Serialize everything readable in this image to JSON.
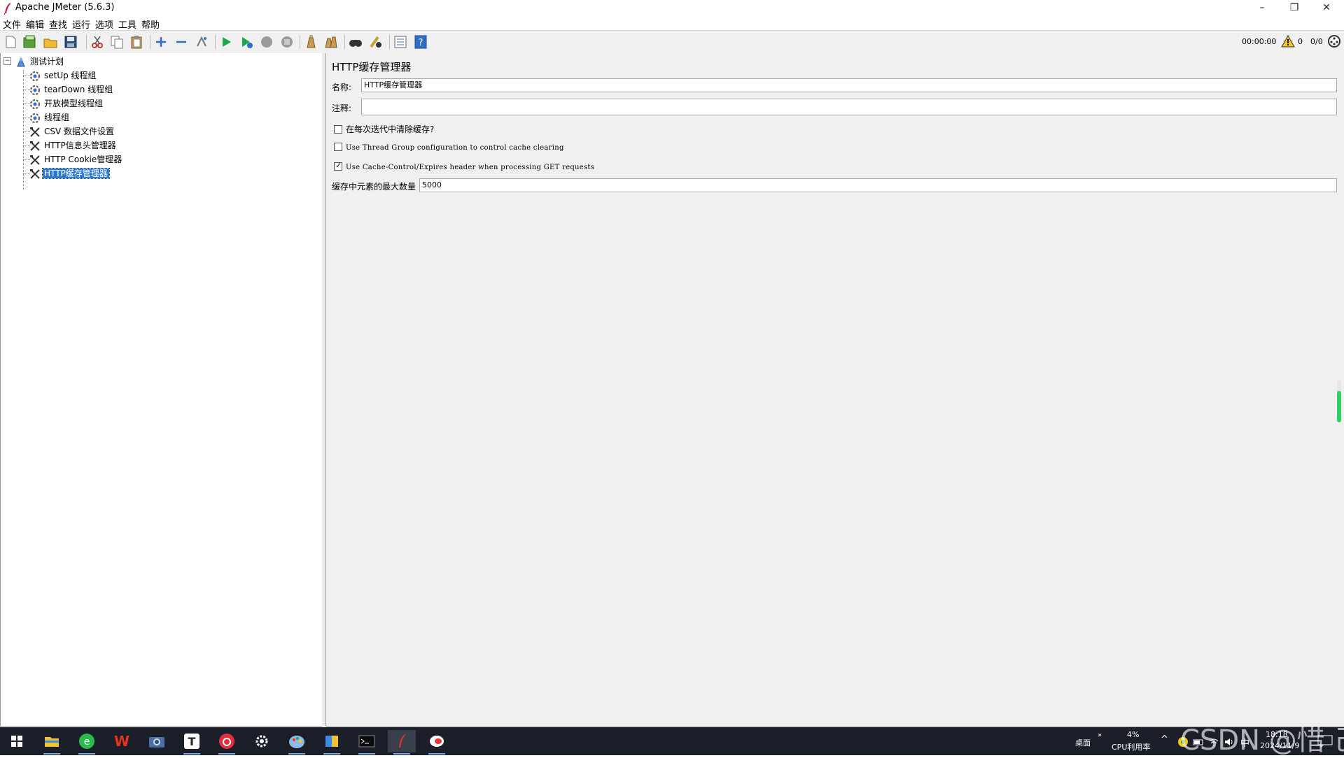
{
  "window": {
    "title": "Apache JMeter (5.6.3)",
    "controls": {
      "minimize": "–",
      "restore": "❐",
      "close": "✕"
    }
  },
  "menu": [
    "文件",
    "编辑",
    "查找",
    "运行",
    "选项",
    "工具",
    "帮助"
  ],
  "toolbar": {
    "icons": [
      "new-icon",
      "templates-icon",
      "open-icon",
      "save-icon",
      "cut-icon",
      "copy-icon",
      "paste-icon",
      "expand-icon",
      "collapse-icon",
      "toggle-icon",
      "start-icon",
      "start-no-pause-icon",
      "stop-icon",
      "shutdown-icon",
      "clear-icon",
      "clear-all-icon",
      "search-icon",
      "reset-search-icon",
      "function-helper-icon",
      "help-icon"
    ],
    "timer": "00:00:00",
    "warning_count": "0",
    "threads": "0/0"
  },
  "tree": {
    "root": "测试计划",
    "children": [
      {
        "label": "setUp 线程组",
        "icon": "thread-group-icon"
      },
      {
        "label": "tearDown 线程组",
        "icon": "thread-group-icon"
      },
      {
        "label": "开放模型线程组",
        "icon": "thread-group-icon"
      },
      {
        "label": "线程组",
        "icon": "thread-group-icon"
      },
      {
        "label": "CSV 数据文件设置",
        "icon": "config-element-icon"
      },
      {
        "label": "HTTP信息头管理器",
        "icon": "config-element-icon"
      },
      {
        "label": "HTTP Cookie管理器",
        "icon": "config-element-icon"
      },
      {
        "label": "HTTP缓存管理器",
        "icon": "config-element-icon",
        "selected": true
      }
    ]
  },
  "panel": {
    "title": "HTTP缓存管理器",
    "name_label": "名称:",
    "name_value": "HTTP缓存管理器",
    "comment_label": "注释:",
    "comment_value": "",
    "checkboxes": [
      {
        "label": "在每次迭代中清除缓存?",
        "checked": false
      },
      {
        "label": "Use Thread Group configuration to control cache clearing",
        "checked": false
      },
      {
        "label": "Use Cache-Control/Expires header when processing GET requests",
        "checked": true
      }
    ],
    "max_elements_label": "缓存中元素的最大数量",
    "max_elements_value": "5000"
  },
  "memory_gauge_level": 0.75,
  "taskbar": {
    "apps": [
      "start-icon",
      "file-explorer-icon",
      "browser-icon",
      "wps-icon",
      "camera-icon",
      "typora-icon",
      "netease-music-icon",
      "settings-icon",
      "paint-icon",
      "folder-app-icon",
      "terminal-icon",
      "jmeter-icon",
      "chat-app-icon"
    ],
    "desktop_label": "桌面",
    "cpu_percent": "4%",
    "cpu_label": "CPU利用率",
    "ime": "中",
    "time": "18:18",
    "date": "2024/11/9"
  },
  "watermark": "CSDN @惜 己"
}
